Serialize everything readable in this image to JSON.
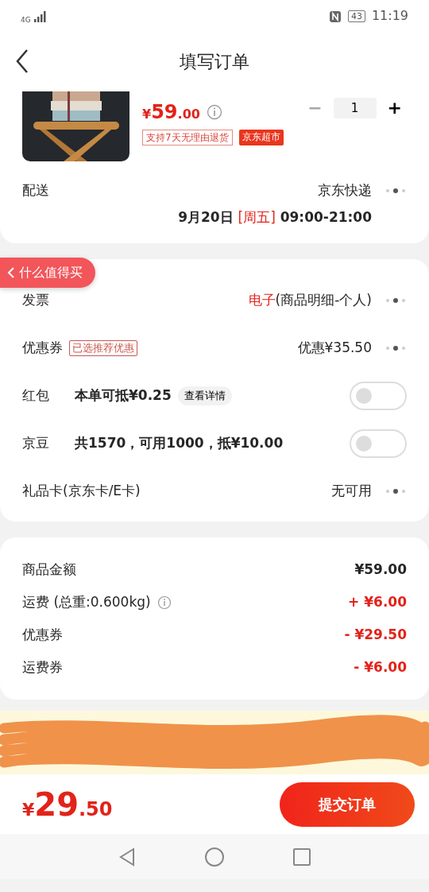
{
  "status_bar": {
    "network": "4G",
    "battery": "43",
    "time": "11:19"
  },
  "header": {
    "title": "填写订单"
  },
  "product": {
    "kind": "picture",
    "price_parts": [
      "¥",
      "59",
      ".00"
    ],
    "tags": [
      {
        "label": "支持7天无理由退货",
        "kind": "outline"
      },
      {
        "label": "京东超市",
        "kind": "filled"
      }
    ],
    "minus": "−",
    "quantity": "1",
    "plus": "+",
    "minus_disabled": true
  },
  "delivery": {
    "label": "配送",
    "carrier": "京东快递",
    "date": "9月20日",
    "weekday": "[周五]",
    "time": "09:00-21:00"
  },
  "floating_button": {
    "label": "什么值得买"
  },
  "options": [
    {
      "kind": "link",
      "label": "发票",
      "value_highlight": "电子",
      "value": "(商品明细-个人)"
    },
    {
      "kind": "link",
      "label": "优惠券",
      "tag": "已选推荐优惠",
      "value": "优惠¥35.50"
    },
    {
      "kind": "toggle",
      "label": "红包",
      "detail": "本单可抵¥0.25",
      "chip": "查看详情",
      "on": false
    },
    {
      "kind": "toggle",
      "label": "京豆",
      "detail": "共1570，可用1000，抵¥10.00",
      "on": false
    },
    {
      "kind": "link",
      "label": "礼品卡(京东卡/E卡)",
      "value": "无可用"
    }
  ],
  "summary": [
    {
      "label": "商品金额",
      "value": "¥59.00",
      "kind": "plain"
    },
    {
      "label": "运费 (总重:0.600kg)",
      "value": "+ ¥6.00",
      "kind": "red",
      "info": true
    },
    {
      "label": "优惠券",
      "value": "- ¥29.50",
      "kind": "red"
    },
    {
      "label": "运费券",
      "value": "- ¥6.00",
      "kind": "red"
    }
  ],
  "footer": {
    "total_parts": [
      "¥",
      "29",
      ".50"
    ],
    "submit": "提交订单"
  }
}
